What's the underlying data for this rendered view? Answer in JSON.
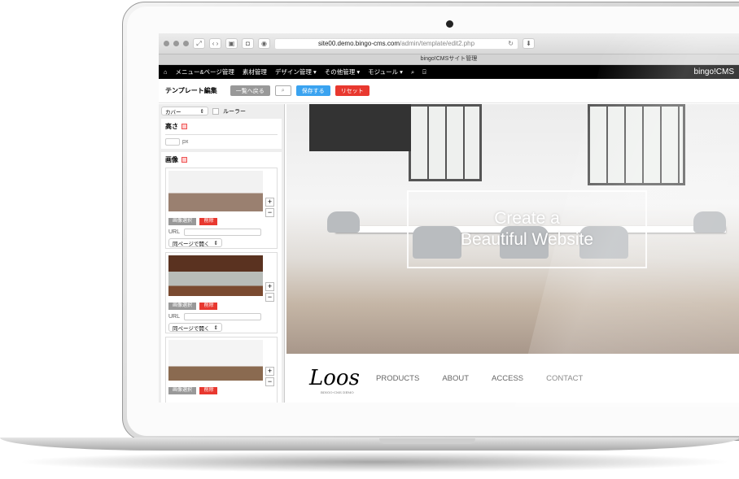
{
  "browser": {
    "url_host": "site00.demo.bingo-cms.com",
    "url_path": "/admin/template/edit2.php",
    "tab_title": "bingo!CMSサイト管理"
  },
  "nav": {
    "items": [
      "メニュー&ページ管理",
      "素材管理",
      "デザイン管理 ▾",
      "その他管理 ▾",
      "モジュール ▾"
    ],
    "brand": "bingo!CMS"
  },
  "toolbar": {
    "title": "テンプレート編集",
    "back": "一覧へ戻る",
    "save": "保存する",
    "reset": "リセット",
    "colors": {
      "back": "#999999",
      "save": "#3aa3f0",
      "reset": "#e8382f"
    }
  },
  "sidebar": {
    "type_select": "カバー",
    "ruler_label": "ルーラー",
    "height_label": "高さ",
    "height_unit": "px",
    "image_label": "画像",
    "cards": [
      {
        "select_btn": "画像選択",
        "delete_btn": "削除",
        "url_label": "URL",
        "link_target": "同ページで開く"
      },
      {
        "select_btn": "画像選択",
        "delete_btn": "削除",
        "url_label": "URL",
        "link_target": "同ページで開く"
      },
      {
        "select_btn": "画像選択",
        "delete_btn": "削除"
      }
    ]
  },
  "preview": {
    "hero_line1": "Create a",
    "hero_line2": "Beautiful Website",
    "logo": "Loos",
    "logo_sub": "BINGO-CMS DEMO",
    "menu": [
      "PRODUCTS",
      "ABOUT",
      "ACCESS",
      "CONTACT"
    ]
  }
}
